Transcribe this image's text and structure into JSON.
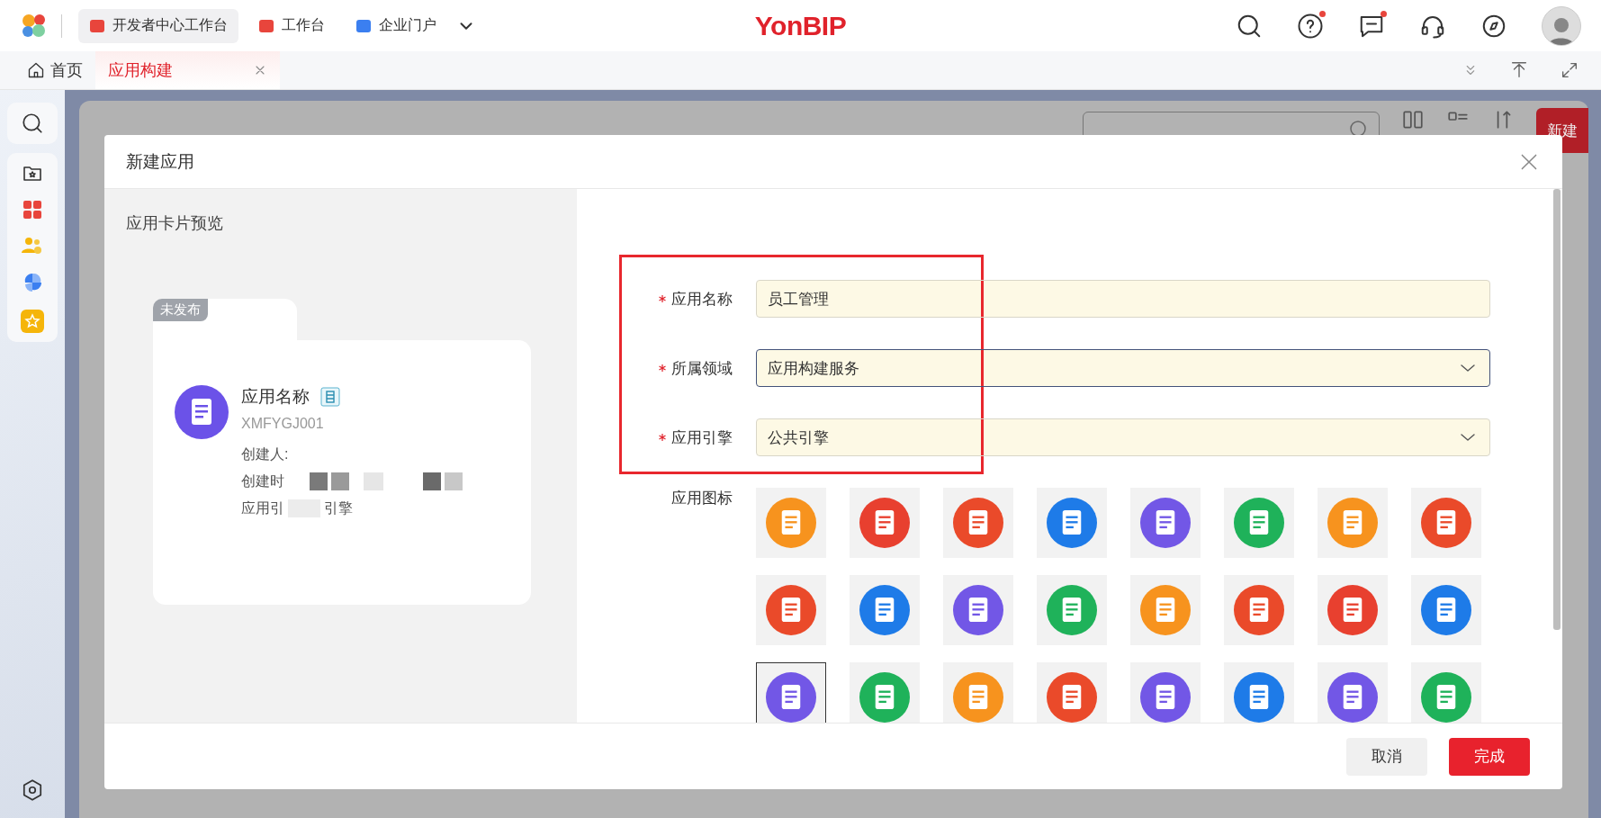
{
  "top_bar": {
    "logo_text": "YonBIP",
    "tabs": [
      {
        "label": "开发者中心工作台",
        "selected": true,
        "color": "#e8453c"
      },
      {
        "label": "工作台",
        "selected": false,
        "color": "#e8453c"
      },
      {
        "label": "企业门户",
        "selected": false,
        "color": "#3b7ff0"
      }
    ],
    "help_badge": true,
    "message_badge": true
  },
  "page_tabs": [
    {
      "label": "首页",
      "kind": "home",
      "selected": false
    },
    {
      "label": "应用构建",
      "kind": "closable",
      "selected": true
    }
  ],
  "background_page": {
    "new_button": "新建"
  },
  "dialog": {
    "title": "新建应用",
    "preview": {
      "heading": "应用卡片预览",
      "status_badge": "未发布",
      "app_name": "应用名称",
      "app_code": "XMFYGJ001",
      "creator_label": "创建人:",
      "created_label": "创建时",
      "engine_label": "应用引",
      "engine_value": "引擎"
    },
    "fields": [
      {
        "label": "应用名称",
        "required": true,
        "kind": "input",
        "value": "员工管理",
        "focused": false
      },
      {
        "label": "所属领域",
        "required": true,
        "kind": "select",
        "value": "应用构建服务",
        "focused": true
      },
      {
        "label": "应用引擎",
        "required": true,
        "kind": "select",
        "value": "公共引擎",
        "focused": false
      }
    ],
    "icon_label": "应用图标",
    "icons": [
      {
        "color": "#f7931e",
        "selected": false
      },
      {
        "color": "#e8402f",
        "selected": false
      },
      {
        "color": "#ea4a2a",
        "selected": false
      },
      {
        "color": "#1e7be8",
        "selected": false
      },
      {
        "color": "#7257e6",
        "selected": false
      },
      {
        "color": "#1fb25a",
        "selected": false
      },
      {
        "color": "#f7931e",
        "selected": false
      },
      {
        "color": "#ea4a2a",
        "selected": false
      },
      {
        "color": "#ea4a2a",
        "selected": false
      },
      {
        "color": "#1e7be8",
        "selected": false
      },
      {
        "color": "#7257e6",
        "selected": false
      },
      {
        "color": "#1fb25a",
        "selected": false
      },
      {
        "color": "#f7931e",
        "selected": false
      },
      {
        "color": "#ea4a2a",
        "selected": false
      },
      {
        "color": "#e8402f",
        "selected": false
      },
      {
        "color": "#1e7be8",
        "selected": false
      },
      {
        "color": "#7257e6",
        "selected": true
      },
      {
        "color": "#1fb25a",
        "selected": false
      },
      {
        "color": "#f7931e",
        "selected": false
      },
      {
        "color": "#ea4a2a",
        "selected": false
      },
      {
        "color": "#7257e6",
        "selected": false
      },
      {
        "color": "#1e7be8",
        "selected": false
      },
      {
        "color": "#7257e6",
        "selected": false
      },
      {
        "color": "#1fb25a",
        "selected": false
      }
    ],
    "buttons": [
      {
        "label": "取消",
        "kind": "secondary"
      },
      {
        "label": "完成",
        "kind": "primary"
      }
    ]
  }
}
